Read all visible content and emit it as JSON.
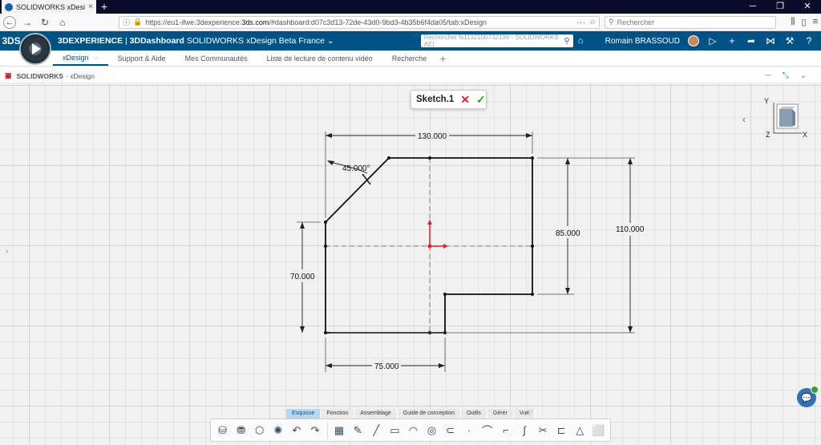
{
  "browser": {
    "tab_title": "SOLIDWORKS xDesign Beta Fra...",
    "url_prefix": "https://eu1-ifwe.3dexperience.",
    "url_domain": "3ds.com",
    "url_rest": "/#dashboard:d07c3d13-72de-43d0-9bd3-4b35b6f4da05/tab:xDesign",
    "search_placeholder": "Rechercher",
    "more_dots": "···"
  },
  "header": {
    "logo": "3DS",
    "brand": "3DEXPERIENCE",
    "separator": " | ",
    "app": "3DDashboard",
    "context": " SOLIDWORKS xDesign Beta France",
    "search_placeholder": "Rechercher N1132100732196 - SOLIDWORKS AE(",
    "user": "Romain BRASSOUD"
  },
  "tabs": [
    {
      "label": "xDesign"
    },
    {
      "label": "Support & Aide"
    },
    {
      "label": "Mes Communautés"
    },
    {
      "label": "Liste de lecture de contenu vidéo"
    },
    {
      "label": "Recherche"
    }
  ],
  "widget": {
    "brand": "SOLIDWORKS",
    "title": "- xDesign"
  },
  "sketch": {
    "name": "Sketch.1",
    "dimensions": {
      "top_width": "130.000",
      "angle": "45.000°",
      "right_inner": "85.000",
      "right_total": "110.000",
      "left_height": "70.000",
      "bottom_width": "75.000"
    }
  },
  "viewcube": {
    "y_label": "Y",
    "z_label": "Z",
    "x_label": "X"
  },
  "action_tabs": [
    {
      "label": "Esquisse"
    },
    {
      "label": "Fonction"
    },
    {
      "label": "Assemblage"
    },
    {
      "label": "Guide de conception"
    },
    {
      "label": "Outils"
    },
    {
      "label": "Gérer"
    },
    {
      "label": "Vue"
    }
  ],
  "colors": {
    "header_bg": "#005386",
    "cancel": "#d9232e",
    "confirm": "#3a9b2f",
    "origin_red": "#e02020"
  }
}
